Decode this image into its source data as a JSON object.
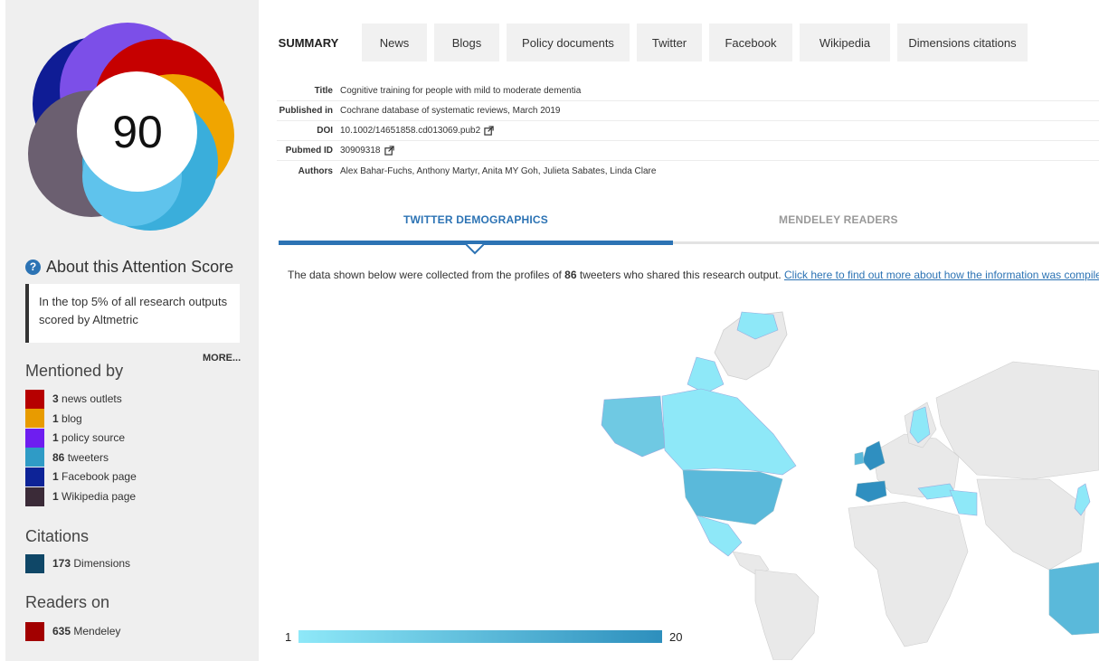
{
  "score": {
    "value": "90",
    "ring_colors": [
      "#a91f13",
      "#e89500",
      "#3e2f3f",
      "#4f85d3",
      "#2f9bd5",
      "#6e46e0",
      "#0f1c95"
    ]
  },
  "about": {
    "icon": "question-circle-icon",
    "label": "About this Attention Score",
    "top_text": "In the top 5% of all research outputs scored by Altmetric",
    "more_label": "MORE..."
  },
  "mentioned_by": {
    "heading": "Mentioned by",
    "items": [
      {
        "count": "3",
        "label": " news outlets",
        "color": "#b60000"
      },
      {
        "count": "1",
        "label": " blog",
        "color": "#e89b00"
      },
      {
        "count": "1",
        "label": " policy source",
        "color": "#6e1ef0"
      },
      {
        "count": "86",
        "label": " tweeters",
        "color": "#2f9bc6"
      },
      {
        "count": "1",
        "label": " Facebook page",
        "color": "#0d2397"
      },
      {
        "count": "1",
        "label": " Wikipedia page",
        "color": "#3b2b38"
      }
    ]
  },
  "citations": {
    "heading": "Citations",
    "items": [
      {
        "count": "173",
        "label": " Dimensions",
        "color": "#0f4767"
      }
    ]
  },
  "readers": {
    "heading": "Readers on",
    "items": [
      {
        "count": "635",
        "label": " Mendeley",
        "color": "#a20000"
      }
    ]
  },
  "tabs": [
    {
      "label": "SUMMARY",
      "active": true
    },
    {
      "label": "News"
    },
    {
      "label": "Blogs"
    },
    {
      "label": "Policy documents"
    },
    {
      "label": "Twitter"
    },
    {
      "label": "Facebook"
    },
    {
      "label": "Wikipedia"
    },
    {
      "label": "Dimensions citations"
    }
  ],
  "meta": {
    "title_label": "Title",
    "title": "Cognitive training for people with mild to moderate dementia",
    "published_label": "Published in",
    "published": "Cochrane database of systematic reviews, March 2019",
    "doi_label": "DOI",
    "doi": "10.1002/14651858.cd013069.pub2",
    "pubmed_label": "Pubmed ID",
    "pubmed": "30909318",
    "authors_label": "Authors",
    "authors": "Alex Bahar-Fuchs, Anthony Martyr, Anita MY Goh, Julieta Sabates, Linda Clare"
  },
  "demographics": {
    "twitter_tab": "TWITTER DEMOGRAPHICS",
    "mendeley_tab": "MENDELEY READERS",
    "desc_prefix": "The data shown below were collected from the profiles of ",
    "desc_count": "86",
    "desc_suffix": " tweeters who shared this research output. ",
    "desc_link": "Click here to find out more about how the information was compiled."
  },
  "map_scale": {
    "min": "1",
    "max": "20",
    "color_low": "#8ee8f8",
    "color_high": "#2d8fbd",
    "land_color": "#e9e9e9"
  }
}
